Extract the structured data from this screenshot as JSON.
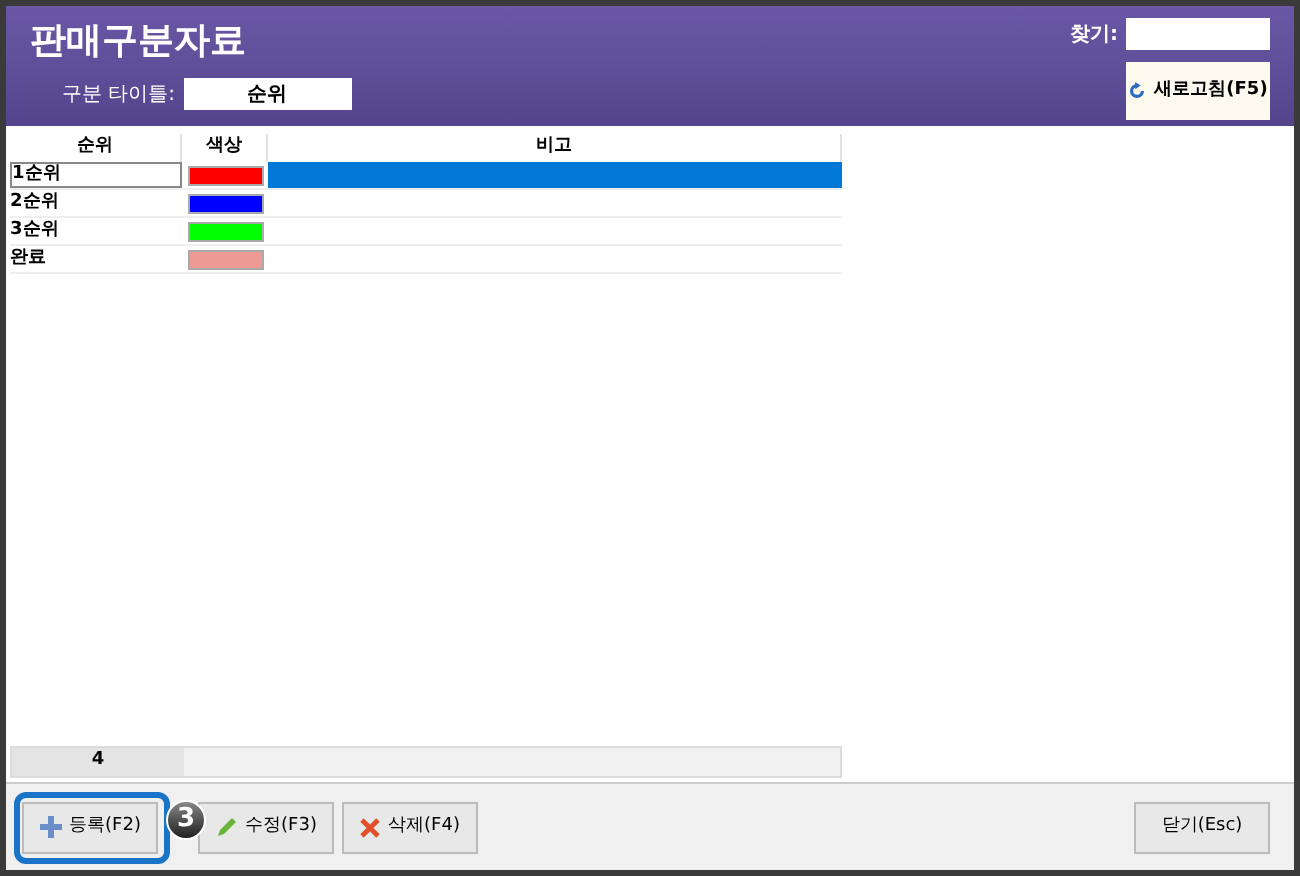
{
  "window": {
    "title": "판매구분자료"
  },
  "header": {
    "title_label": "구분 타이틀:",
    "title_value": "순위",
    "search_label": "찾기:",
    "refresh_button": "새로고침(F5)"
  },
  "table": {
    "columns": [
      "순위",
      "색상",
      "비고"
    ],
    "rows": [
      {
        "name": "1순위",
        "color": "#ff0000",
        "selected": true
      },
      {
        "name": "2순위",
        "color": "#0000ff",
        "selected": false
      },
      {
        "name": "3순위",
        "color": "#00ff00",
        "selected": false
      },
      {
        "name": "완료",
        "color": "#ee9a94",
        "selected": false
      }
    ],
    "footer_count": "4"
  },
  "buttons": [
    {
      "label": "등록(F2)",
      "kind": "add",
      "highlighted": true
    },
    {
      "label": "수정(F3)",
      "kind": "edit",
      "highlighted": false
    },
    {
      "label": "삭제(F4)",
      "kind": "delete",
      "highlighted": false
    }
  ],
  "callout": {
    "label": "3"
  },
  "close_button": "닫기(Esc)"
}
